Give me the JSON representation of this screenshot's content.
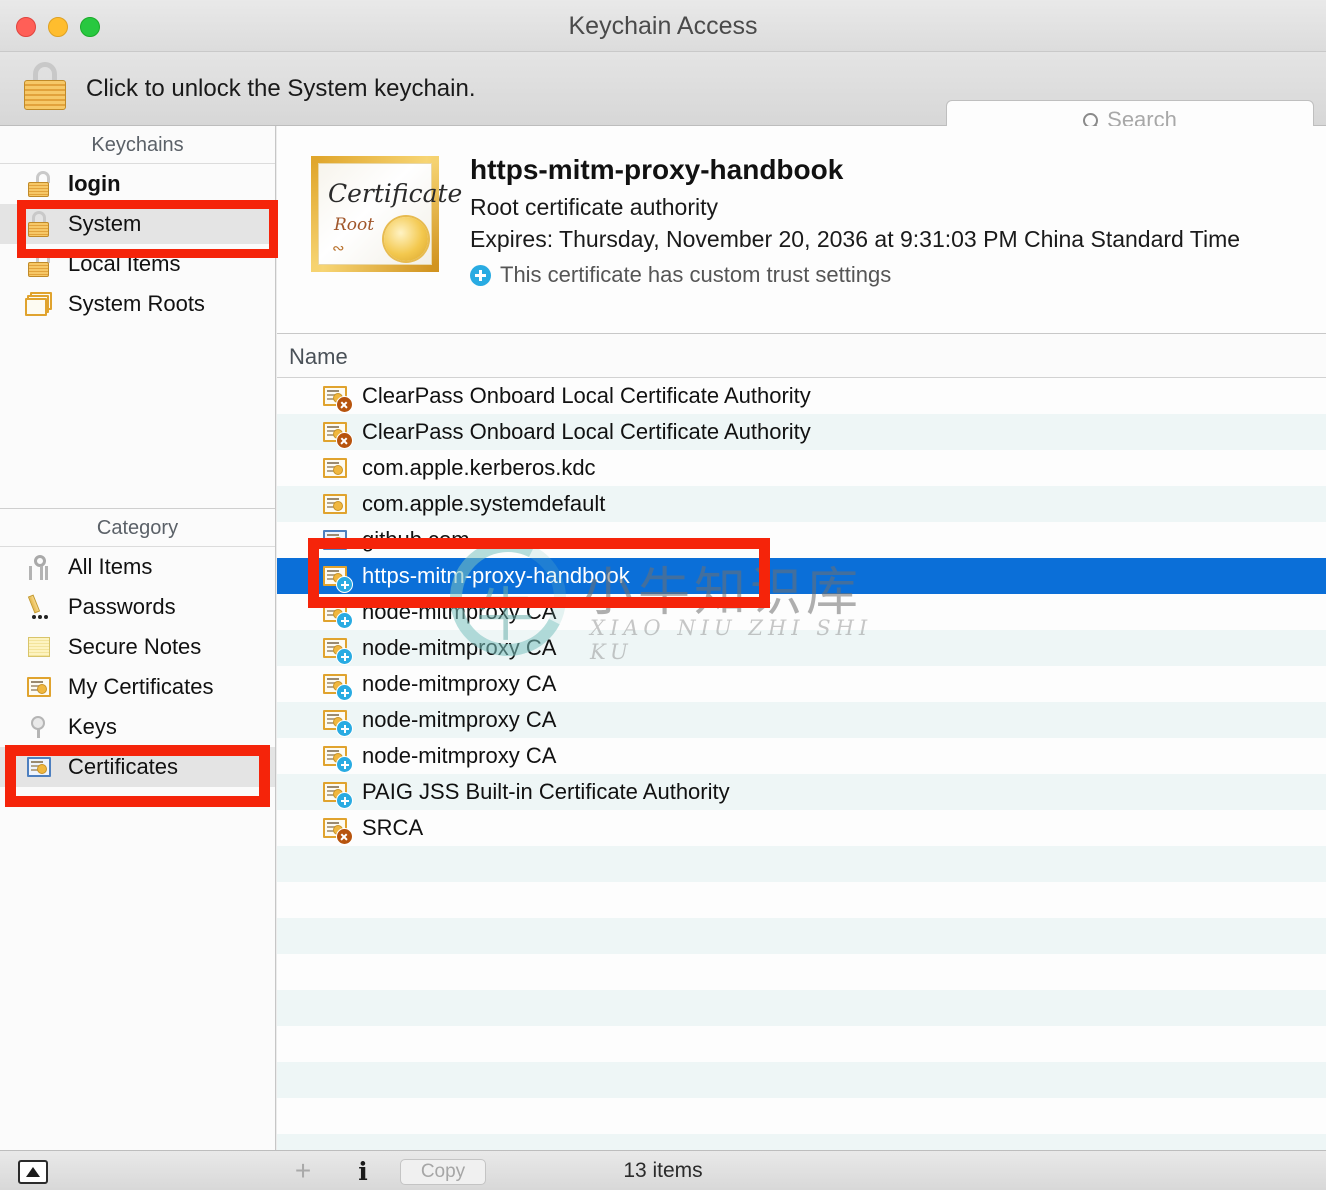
{
  "window": {
    "title": "Keychain Access",
    "traffic_lights": [
      "close-button",
      "minimize-button",
      "zoom-button"
    ]
  },
  "toolbar": {
    "lock_icon": "padlock-locked-icon",
    "unlock_message": "Click to unlock the System keychain.",
    "search": {
      "icon": "search-icon",
      "placeholder": "Search",
      "value": ""
    }
  },
  "sidebar": {
    "keychains_header": "Keychains",
    "keychains": [
      {
        "label": "login",
        "icon": "padlock-open-icon",
        "bold": true,
        "selected": false
      },
      {
        "label": "System",
        "icon": "padlock-locked-icon",
        "bold": false,
        "selected": true
      },
      {
        "label": "Local Items",
        "icon": "padlock-open-icon",
        "bold": false,
        "selected": false
      },
      {
        "label": "System Roots",
        "icon": "certificate-stack-icon",
        "bold": false,
        "selected": false
      }
    ],
    "category_header": "Category",
    "categories": [
      {
        "label": "All Items",
        "icon": "keys-icon",
        "selected": false
      },
      {
        "label": "Passwords",
        "icon": "pencil-dots-icon",
        "selected": false
      },
      {
        "label": "Secure Notes",
        "icon": "note-icon",
        "selected": false
      },
      {
        "label": "My Certificates",
        "icon": "certificate-icon",
        "selected": false
      },
      {
        "label": "Keys",
        "icon": "key-disc-icon",
        "selected": false
      },
      {
        "label": "Certificates",
        "icon": "certificate-blue-icon",
        "selected": true
      }
    ]
  },
  "detail": {
    "icon": "root-certificate-icon",
    "icon_text_main": "Certificate",
    "icon_text_sub": "Root",
    "name": "https-mitm-proxy-handbook",
    "kind": "Root certificate authority",
    "expires": "Expires: Thursday, November 20, 2036 at 9:31:03 PM China Standard Time",
    "trust_badge_icon": "plus-badge-icon",
    "trust_note": "This certificate has custom trust settings"
  },
  "list": {
    "column_header": "Name",
    "rows": [
      {
        "name": "ClearPass Onboard Local Certificate Authority",
        "icon": "certificate-icon",
        "badge": "x-badge-icon",
        "selected": false
      },
      {
        "name": "ClearPass Onboard Local Certificate Authority",
        "icon": "certificate-icon",
        "badge": "x-badge-icon",
        "selected": false
      },
      {
        "name": "com.apple.kerberos.kdc",
        "icon": "certificate-icon",
        "badge": "",
        "selected": false
      },
      {
        "name": "com.apple.systemdefault",
        "icon": "certificate-icon",
        "badge": "",
        "selected": false
      },
      {
        "name": "github.com",
        "icon": "certificate-blue-icon",
        "badge": "",
        "selected": false
      },
      {
        "name": "https-mitm-proxy-handbook",
        "icon": "certificate-icon",
        "badge": "plus-badge-icon",
        "selected": true
      },
      {
        "name": "node-mitmproxy CA",
        "icon": "certificate-icon",
        "badge": "plus-badge-icon",
        "selected": false
      },
      {
        "name": "node-mitmproxy CA",
        "icon": "certificate-icon",
        "badge": "plus-badge-icon",
        "selected": false
      },
      {
        "name": "node-mitmproxy CA",
        "icon": "certificate-icon",
        "badge": "plus-badge-icon",
        "selected": false
      },
      {
        "name": "node-mitmproxy CA",
        "icon": "certificate-icon",
        "badge": "plus-badge-icon",
        "selected": false
      },
      {
        "name": "node-mitmproxy CA",
        "icon": "certificate-icon",
        "badge": "plus-badge-icon",
        "selected": false
      },
      {
        "name": "PAIG JSS Built-in Certificate Authority",
        "icon": "certificate-icon",
        "badge": "plus-badge-icon",
        "selected": false
      },
      {
        "name": "SRCA",
        "icon": "certificate-icon",
        "badge": "x-badge-icon",
        "selected": false
      }
    ]
  },
  "watermark": {
    "glyph": "牛",
    "chinese": "小牛知识库",
    "pinyin": "XIAO NIU ZHI SHI KU"
  },
  "annotations": {
    "color": "#f5240a",
    "boxes": [
      "system-keychain-highlight",
      "certificates-category-highlight",
      "selected-certificate-highlight"
    ]
  },
  "bottombar": {
    "sidebar_toggle_icon": "sidebar-toggle-icon",
    "add_label": "+",
    "info_label": "i",
    "copy_label": "Copy",
    "item_count": "13 items"
  }
}
